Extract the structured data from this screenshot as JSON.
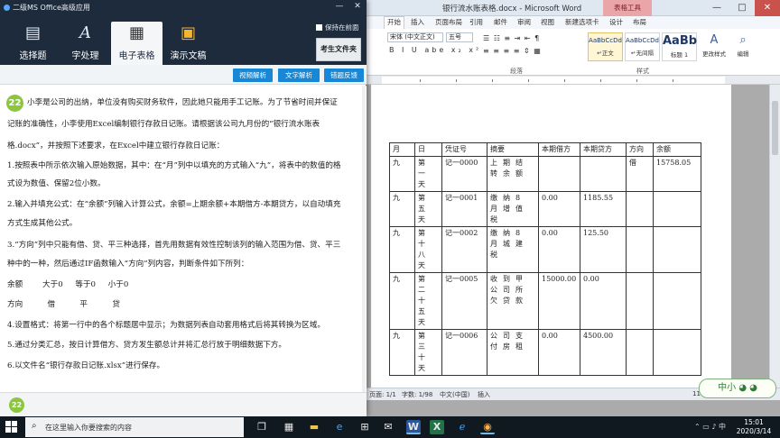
{
  "colors": {
    "app_header": "#1d2b3d",
    "action_button": "#1787d6",
    "question_badge": "#8cc63f",
    "word_close": "#c9524d",
    "table_tools": "#e9a5a8"
  },
  "word": {
    "title": "银行流水账表格.docx - Microsoft Word",
    "context_tab": "表格工具",
    "window_buttons": {
      "minimize": "—",
      "maximize": "□",
      "close": "✕"
    },
    "tabs": [
      "开始",
      "插入",
      "页面布局",
      "引用",
      "邮件",
      "审阅",
      "视图",
      "新建选项卡",
      "设计",
      "布局"
    ],
    "active_tab": "开始",
    "ribbon": {
      "font_name": "宋体 (中文正文)",
      "font_size": "五号",
      "format_row": "B I U abe x₂ x²",
      "paragraph_label": "段落",
      "styles_label": "样式",
      "styles": [
        {
          "sample": "AaBbCcDd",
          "name": "↵正文"
        },
        {
          "sample": "AaBbCcDd",
          "name": "↵无间隔"
        },
        {
          "sample": "AaBb",
          "name": "标题 1"
        }
      ],
      "change_styles": "更改样式",
      "edit": "编辑"
    },
    "table": {
      "headers": [
        "月",
        "日",
        "凭证号",
        "摘要",
        "本期借方",
        "本期贷方",
        "方向",
        "余额"
      ],
      "rows": [
        [
          "九",
          "第一天",
          "记一0000",
          "上期结转余额",
          "",
          "",
          "借",
          "15758.05"
        ],
        [
          "九",
          "第五天",
          "记一0001",
          "缴纳8月增值税",
          "0.00",
          "1185.55",
          "",
          ""
        ],
        [
          "九",
          "第十八天",
          "记一0002",
          "缴纳8月城建税",
          "0.00",
          "125.50",
          "",
          ""
        ],
        [
          "九",
          "第二十五天",
          "记一0005",
          "收到甲公司所欠贷款",
          "15000.00",
          "0.00",
          "",
          ""
        ],
        [
          "九",
          "第三十天",
          "记一0006",
          "公司支付房租",
          "0.00",
          "4500.00",
          "",
          ""
        ]
      ]
    },
    "status": {
      "page": "页面: 1/1",
      "words": "字数: 1/98",
      "language": "中文(中国)",
      "mode": "插入",
      "zoom": "110%"
    },
    "logo_text": "中小 ◕ ◕"
  },
  "app": {
    "title": "二级MS Office高级应用",
    "window_buttons": {
      "minimize": "—",
      "close": "✕"
    },
    "pin_label": "保持在前面",
    "tabs": [
      {
        "label": "选择题",
        "icon": "book-icon"
      },
      {
        "label": "字处理",
        "icon": "letter-a-icon"
      },
      {
        "label": "电子表格",
        "icon": "spreadsheet-icon"
      },
      {
        "label": "演示文稿",
        "icon": "slideshow-icon"
      }
    ],
    "active_tab": "电子表格",
    "folder_button": "考生文件夹",
    "toolbar": {
      "video": "视频解析",
      "text": "文字解析",
      "error": "错题反馈"
    },
    "question_number": "22",
    "question_lines": [
      "小李是公司的出纳，单位没有购买财务软件，因此她只能用手工记账。为了节省时间并保证",
      "记账的准确性，小李使用Excel编制银行存款日记账。请根据该公司九月份的“银行流水账表",
      "格.docx”，并按照下述要求，在Excel中建立银行存款日记账：",
      "1.按照表中所示依次输入原始数据，其中：在“月”列中以填充的方式输入“九”，将表中的数值的格",
      "式设为数值、保留2位小数。",
      "2.输入并填充公式：在“余额”列输入计算公式，余额=上期余额+本期借方-本期贷方，以自动填充",
      "方式生成其他公式。",
      "3.“方向”列中只能有借、贷、平三种选择，首先用数据有效性控制该列的输入范围为借、贷、平三",
      "种中的一种，然后通过IF函数输入“方向”列内容，判断条件如下所列：",
      "余额        大于0     等于0     小于0",
      "方向          借          平          贷",
      "4.设置格式：将第一行中的各个标题居中显示；为数据列表自动套用格式后将其转换为区域。",
      "5.通过分类汇总，按日计算借方、贷方发生额总计并将汇总行放于明细数据下方。",
      "6.以文件名“银行存款日记账.xlsx”进行保存。"
    ],
    "bottom_number": "22"
  },
  "taskbar": {
    "search_placeholder": "在这里输入你要搜索的内容",
    "apps": [
      "task-view-icon",
      "calculator-icon",
      "folder-icon",
      "edge-icon",
      "store-icon",
      "mail-icon",
      "word-icon",
      "excel-icon",
      "ie-icon",
      "exam-app-icon"
    ],
    "time": "15:01",
    "date": "2020/3/14"
  }
}
